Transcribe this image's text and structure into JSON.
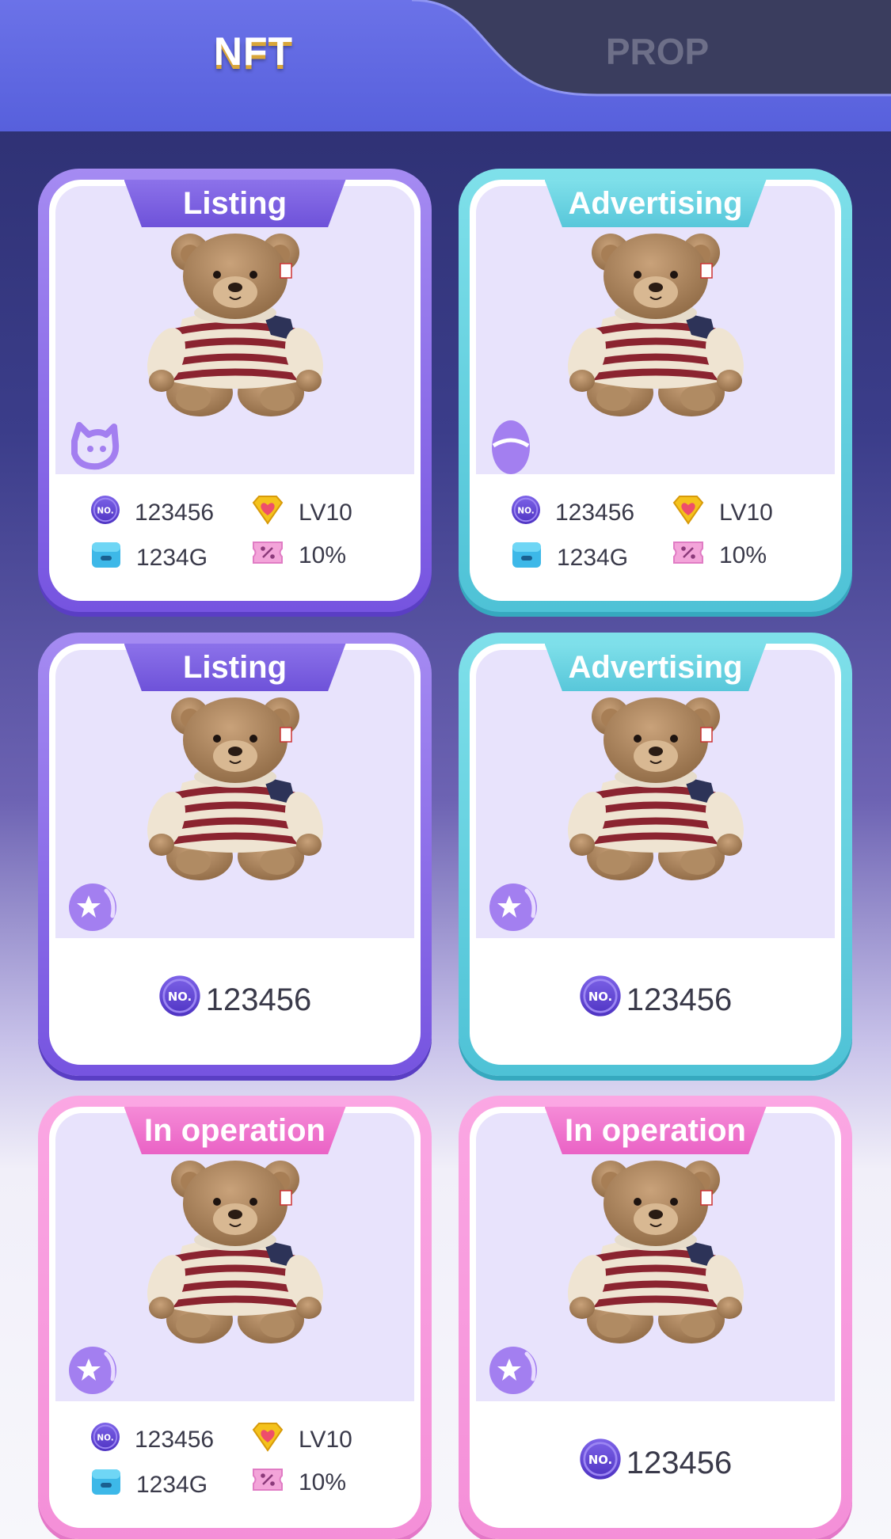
{
  "tabs": {
    "nft_label": "NFT",
    "prop_label": "PROP"
  },
  "no_badge_text": "NO.",
  "cards": [
    {
      "status": "Listing",
      "theme": "purple",
      "badge_icon": "purple-cat-icon",
      "number": "123456",
      "level": "LV10",
      "gold": "1234G",
      "rate": "10%"
    },
    {
      "status": "Advertising",
      "theme": "cyan",
      "badge_icon": "purple-egg-icon",
      "number": "123456",
      "level": "LV10",
      "gold": "1234G",
      "rate": "10%"
    },
    {
      "status": "Listing",
      "theme": "purple",
      "badge_icon": "purple-star-orb-icon",
      "number": "123456"
    },
    {
      "status": "Advertising",
      "theme": "cyan",
      "badge_icon": "purple-star-orb-icon",
      "number": "123456"
    },
    {
      "status": "In operation",
      "theme": "pink",
      "badge_icon": "purple-star-orb-icon",
      "number": "123456",
      "level": "LV10",
      "gold": "1234G",
      "rate": "10%"
    },
    {
      "status": "In operation",
      "theme": "pink",
      "badge_icon": "purple-star-orb-icon",
      "number": "123456"
    }
  ]
}
